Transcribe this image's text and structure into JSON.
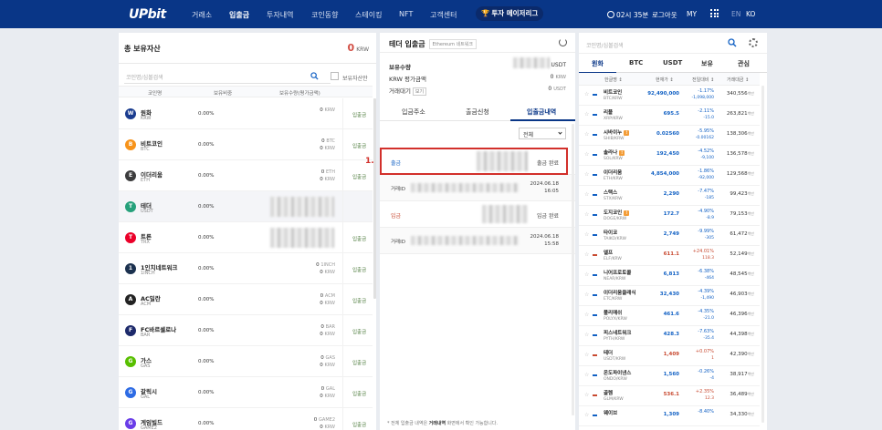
{
  "nav": {
    "logo": "UPbit",
    "items": [
      "거래소",
      "입출금",
      "투자내역",
      "코인동향",
      "스테이킹",
      "NFT",
      "고객센터"
    ],
    "badge": "투자 메이저리그",
    "timer": "02시 35분",
    "logout": "로그아웃",
    "my": "MY",
    "lang_en": "EN",
    "lang_ko": "KO"
  },
  "assets": {
    "title": "총 보유자산",
    "total": "0",
    "total_unit": "KRW",
    "search_placeholder": "코인명/심볼검색",
    "owned_only_label": "보유자산만",
    "columns": [
      "코인명",
      "보유비중",
      "보유수량(평가금액)"
    ],
    "rows": [
      {
        "name": "원화",
        "symbol": "KRW",
        "pct": "0.00%",
        "amount": "0",
        "unit": "KRW",
        "value": "",
        "deposit": "입출금",
        "icon_color": "#1a3c8f",
        "icon_text": "W"
      },
      {
        "name": "비트코인",
        "symbol": "BTC",
        "pct": "0.00%",
        "amount": "0",
        "unit": "BTC",
        "value": "0",
        "value_unit": "KRW",
        "deposit": "입출금",
        "icon_color": "#f7931a",
        "icon_text": "B"
      },
      {
        "name": "이더리움",
        "symbol": "ETH",
        "pct": "0.00%",
        "amount": "0",
        "unit": "ETH",
        "value": "0",
        "value_unit": "KRW",
        "deposit": "입출금",
        "icon_color": "#3c3c3d",
        "icon_text": "E"
      },
      {
        "name": "테더",
        "symbol": "USDT",
        "pct": "0.00%",
        "amount": "",
        "unit": "",
        "value": "",
        "deposit": "",
        "icon_color": "#26a17b",
        "icon_text": "T"
      },
      {
        "name": "트론",
        "symbol": "TRX",
        "pct": "0.00%",
        "amount": "",
        "unit": "",
        "value": "",
        "deposit": "입출금",
        "icon_color": "#eb0029",
        "icon_text": "T"
      },
      {
        "name": "1인치네트워크",
        "symbol": "1INCH",
        "pct": "0.00%",
        "amount": "0",
        "unit": "1INCH",
        "value": "0",
        "value_unit": "KRW",
        "deposit": "입출금",
        "icon_color": "#1b314f",
        "icon_text": "1"
      },
      {
        "name": "AC밀란",
        "symbol": "ACM",
        "pct": "0.00%",
        "amount": "0",
        "unit": "ACM",
        "value": "0",
        "value_unit": "KRW",
        "deposit": "입출금",
        "icon_color": "#222222",
        "icon_text": "A"
      },
      {
        "name": "FC바르셀로나",
        "symbol": "BAR",
        "pct": "0.00%",
        "amount": "0",
        "unit": "BAR",
        "value": "0",
        "value_unit": "KRW",
        "deposit": "입출금",
        "icon_color": "#1d2a6b",
        "icon_text": "F"
      },
      {
        "name": "가스",
        "symbol": "GAS",
        "pct": "0.00%",
        "amount": "0",
        "unit": "GAS",
        "value": "0",
        "value_unit": "KRW",
        "deposit": "입출금",
        "icon_color": "#58bf00",
        "icon_text": "G"
      },
      {
        "name": "갈릭시",
        "symbol": "GAL",
        "pct": "0.00%",
        "amount": "0",
        "unit": "GAL",
        "value": "0",
        "value_unit": "KRW",
        "deposit": "입출금",
        "icon_color": "#2d6be4",
        "icon_text": "G"
      },
      {
        "name": "게임빌드",
        "symbol": "GAME2",
        "pct": "0.00%",
        "amount": "0",
        "unit": "GAME2",
        "value": "0",
        "value_unit": "KRW",
        "deposit": "입출금",
        "icon_color": "#6a3de8",
        "icon_text": "G"
      }
    ]
  },
  "transfer": {
    "title": "테더 입출금",
    "network": "Ethereum 네트워크",
    "holdings_label": "보유수량",
    "holdings_unit": "USDT",
    "krw_label": "KRW 평가금액",
    "krw_value": "0",
    "krw_unit": "KRW",
    "pending_label": "거래대기",
    "pending_pill": "보기",
    "pending_value": "0",
    "pending_unit": "USDT",
    "tabs": [
      "입금주소",
      "출금신청",
      "입출금내역"
    ],
    "filter": "전체",
    "history": [
      {
        "type": "출금",
        "kind": "out",
        "status": "출금 완료",
        "txid_label": "거래ID",
        "date": "2024.06.18",
        "time": "16:05"
      },
      {
        "type": "입금",
        "kind": "in",
        "status": "입금 완료",
        "txid_label": "거래ID",
        "date": "2024.06.18",
        "time": "15:58"
      }
    ],
    "annotation": "1.",
    "footnote_prefix": "* 전체 입출금 내역은 ",
    "footnote_bold": "거래내역",
    "footnote_suffix": " 화면에서 확인 가능합니다."
  },
  "market": {
    "search_placeholder": "코인명/심볼검색",
    "tabs": [
      "원화",
      "BTC",
      "USDT",
      "보유",
      "관심"
    ],
    "columns": [
      "한글명 ↕",
      "현재가 ↕",
      "전일대비 ↕",
      "거래대금 ↕"
    ],
    "rows": [
      {
        "name": "비트코인",
        "symbol": "BTC/KRW",
        "price": "92,490,000",
        "chg": "-1.17%",
        "chg2": "-1,098,000",
        "vol": "340,556",
        "dir": "dn",
        "warn": false
      },
      {
        "name": "리플",
        "symbol": "XRP/KRW",
        "price": "695.5",
        "chg": "-2.11%",
        "chg2": "-15.0",
        "vol": "263,821",
        "dir": "dn",
        "warn": false
      },
      {
        "name": "시바이누",
        "symbol": "SHIB/KRW",
        "price": "0.02560",
        "chg": "-5.95%",
        "chg2": "-0.00162",
        "vol": "138,306",
        "dir": "dn",
        "warn": true
      },
      {
        "name": "솔라나",
        "symbol": "SOL/KRW",
        "price": "192,450",
        "chg": "-4.52%",
        "chg2": "-9,100",
        "vol": "136,578",
        "dir": "dn",
        "warn": true
      },
      {
        "name": "이더리움",
        "symbol": "ETH/KRW",
        "price": "4,854,000",
        "chg": "-1.86%",
        "chg2": "-92,000",
        "vol": "129,568",
        "dir": "dn",
        "warn": false
      },
      {
        "name": "스택스",
        "symbol": "STX/KRW",
        "price": "2,290",
        "chg": "-7.47%",
        "chg2": "-185",
        "vol": "99,423",
        "dir": "dn",
        "warn": false
      },
      {
        "name": "도지코인",
        "symbol": "DOGE/KRW",
        "price": "172.7",
        "chg": "-4.90%",
        "chg2": "-8.9",
        "vol": "79,153",
        "dir": "dn",
        "warn": true
      },
      {
        "name": "타이코",
        "symbol": "TAIKO/KRW",
        "price": "2,749",
        "chg": "-9.99%",
        "chg2": "-305",
        "vol": "61,472",
        "dir": "dn",
        "warn": false
      },
      {
        "name": "엘프",
        "symbol": "ELF/KRW",
        "price": "611.1",
        "chg": "+24.01%",
        "chg2": "118.3",
        "vol": "52,149",
        "dir": "up",
        "warn": false
      },
      {
        "name": "니어프로토콜",
        "symbol": "NEAR/KRW",
        "price": "6,813",
        "chg": "-6.38%",
        "chg2": "-464",
        "vol": "48,545",
        "dir": "dn",
        "warn": false
      },
      {
        "name": "이더리움클래식",
        "symbol": "ETC/KRW",
        "price": "32,430",
        "chg": "-4.39%",
        "chg2": "-1,490",
        "vol": "46,903",
        "dir": "dn",
        "warn": false
      },
      {
        "name": "폴리매쉬",
        "symbol": "POLYX/KRW",
        "price": "461.6",
        "chg": "-4.35%",
        "chg2": "-21.0",
        "vol": "46,396",
        "dir": "dn",
        "warn": false
      },
      {
        "name": "피스네트워크",
        "symbol": "PYTH/KRW",
        "price": "428.3",
        "chg": "-7.63%",
        "chg2": "-35.4",
        "vol": "44,398",
        "dir": "dn",
        "warn": false
      },
      {
        "name": "테더",
        "symbol": "USDT/KRW",
        "price": "1,409",
        "chg": "+0.07%",
        "chg2": "1",
        "vol": "42,390",
        "dir": "up",
        "warn": false
      },
      {
        "name": "온도파이낸스",
        "symbol": "ONDO/KRW",
        "price": "1,560",
        "chg": "-0.26%",
        "chg2": "-4",
        "vol": "38,917",
        "dir": "dn",
        "warn": false
      },
      {
        "name": "골렘",
        "symbol": "GLM/KRW",
        "price": "536.1",
        "chg": "+2.35%",
        "chg2": "12.3",
        "vol": "36,489",
        "dir": "up",
        "warn": false
      },
      {
        "name": "웨이브",
        "symbol": "",
        "price": "1,309",
        "chg": "-8.40%",
        "chg2": "",
        "vol": "34,330",
        "dir": "dn",
        "warn": false
      }
    ],
    "vol_unit": "백만"
  }
}
